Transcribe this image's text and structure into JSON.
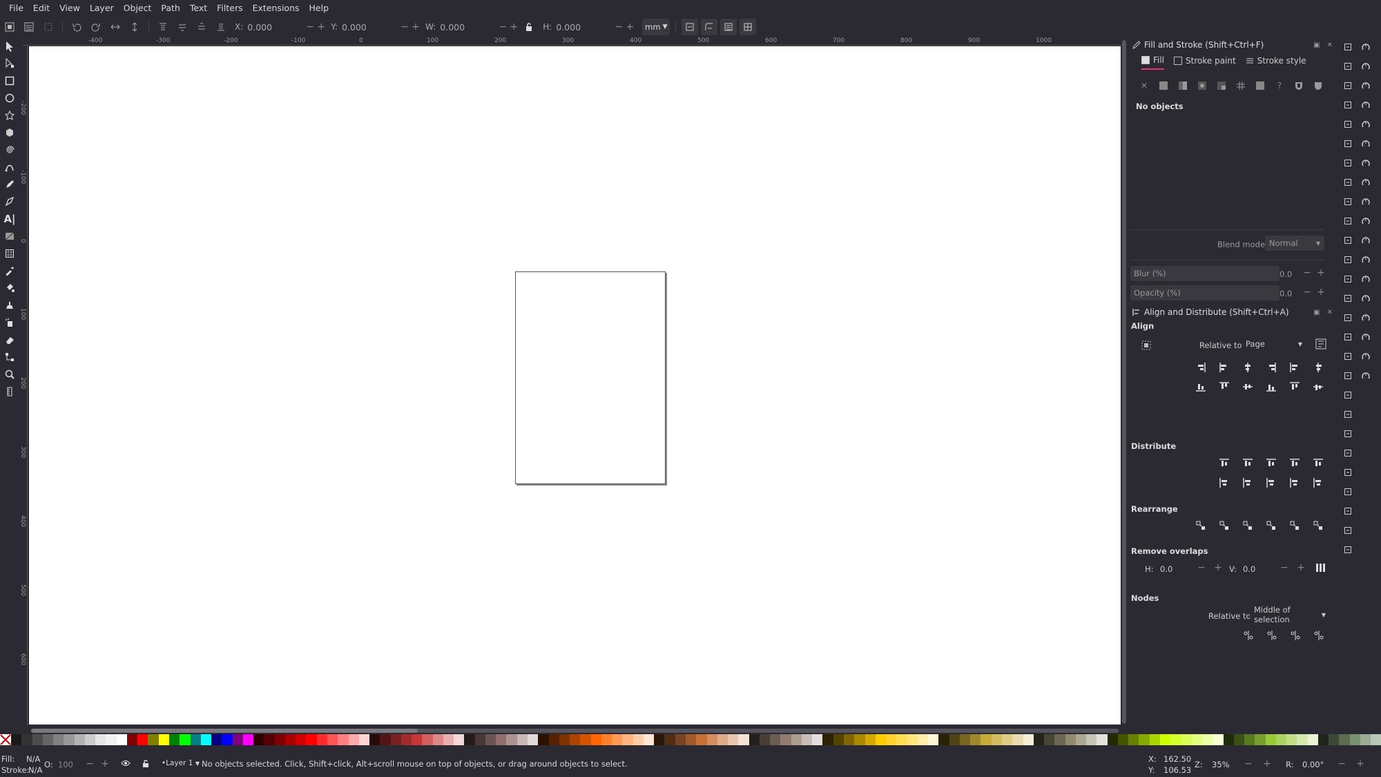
{
  "menu": [
    "File",
    "Edit",
    "View",
    "Layer",
    "Object",
    "Path",
    "Text",
    "Filters",
    "Extensions",
    "Help"
  ],
  "toolbar": {
    "x_label": "X:",
    "x_value": "0.000",
    "y_label": "Y:",
    "y_value": "0.000",
    "w_label": "W:",
    "w_value": "0.000",
    "h_label": "H:",
    "h_value": "0.000",
    "unit": "mm"
  },
  "ruler": {
    "h_ticks": [
      "-400",
      "-300",
      "-200",
      "-100",
      "0",
      "100",
      "200",
      "300",
      "400",
      "500",
      "600",
      "700",
      "800",
      "900",
      "1000"
    ],
    "v_ticks": [
      "-200",
      "-100",
      "0",
      "100",
      "200",
      "300",
      "400",
      "500",
      "600"
    ]
  },
  "fill_stroke": {
    "title": "Fill and Stroke (Shift+Ctrl+F)",
    "tabs": [
      "Fill",
      "Stroke paint",
      "Stroke style"
    ],
    "message": "No objects",
    "blend_label": "Blend mode:",
    "blend_value": "Normal",
    "blur_label": "Blur (%)",
    "blur_value": "0.0",
    "opacity_label": "Opacity (%)",
    "opacity_value": "0.0"
  },
  "align": {
    "title": "Align and Distribute (Shift+Ctrl+A)",
    "align_label": "Align",
    "relative_label": "Relative to:",
    "relative_value": "Page",
    "distribute_label": "Distribute",
    "rearrange_label": "Rearrange",
    "overlaps_label": "Remove overlaps",
    "h_label": "H:",
    "h_value": "0.0",
    "v_label": "V:",
    "v_value": "0.0",
    "nodes_label": "Nodes",
    "nodes_relative_label": "Relative to:",
    "nodes_relative_value": "Middle of selection"
  },
  "palette": [
    "#ffffff",
    "#1a1a1a",
    "#333333",
    "#4d4d4d",
    "#666666",
    "#808080",
    "#999999",
    "#b3b3b3",
    "#cccccc",
    "#e6e6e6",
    "#f2f2f2",
    "#ffffff",
    "#800000",
    "#ff0000",
    "#808000",
    "#ffff00",
    "#008000",
    "#00ff00",
    "#008080",
    "#00ffff",
    "#000080",
    "#0000ff",
    "#800080",
    "#ff00ff",
    "#2b0000",
    "#550000",
    "#800000",
    "#aa0000",
    "#d40000",
    "#ff0000",
    "#ff2a2a",
    "#ff5555",
    "#ff8080",
    "#ffaaaa",
    "#ffd5d5",
    "#280b0b",
    "#501616",
    "#782121",
    "#a02c2c",
    "#c83737",
    "#d35f5f",
    "#de8787",
    "#e9afaf",
    "#f4d7d7",
    "#241c1c",
    "#483737",
    "#6c5353",
    "#916f6f",
    "#ac9393",
    "#c8b7b7",
    "#e3dbdb",
    "#2b1100",
    "#552200",
    "#803300",
    "#aa4400",
    "#d45500",
    "#ff6600",
    "#ff7f2a",
    "#ff9955",
    "#ffb380",
    "#ffccaa",
    "#ffe6d5",
    "#28170b",
    "#502d16",
    "#784421",
    "#a05a2c",
    "#c87137",
    "#d38d5f",
    "#deaa87",
    "#e9c6af",
    "#f4e3d7",
    "#241f1c",
    "#483e37",
    "#6c5d53",
    "#917c6f",
    "#ac9d93",
    "#c8beb7",
    "#e3dedb",
    "#2b2200",
    "#554400",
    "#806600",
    "#aa8800",
    "#d4aa00",
    "#ffcc00",
    "#ffd42a",
    "#ffdd55",
    "#ffe680",
    "#ffeeaa",
    "#fff6d5",
    "#28220b",
    "#504416",
    "#786721",
    "#a0892c",
    "#c8ab37",
    "#d3bc5f",
    "#decd87",
    "#e9ddaf",
    "#f4eed7",
    "#24221c",
    "#484537",
    "#6c6753",
    "#918a6f",
    "#aca793",
    "#c8c4b7",
    "#e3e2db",
    "#222b00",
    "#445500",
    "#668000",
    "#88aa00",
    "#aad400",
    "#ccff00",
    "#d4ff2a",
    "#ddff55",
    "#e5ff80",
    "#eeffaa",
    "#f6ffd5",
    "#1e2b0b",
    "#3c5016",
    "#5a7821",
    "#789f2c",
    "#96c837",
    "#abd35f",
    "#c0de87",
    "#d5e9af",
    "#eaf4d7",
    "#1f241c",
    "#3d4837",
    "#5c6c53",
    "#7a916f",
    "#9aac93",
    "#b7c8b7"
  ],
  "status": {
    "fill_label": "Fill:",
    "fill_value": "N/A",
    "stroke_label": "Stroke:",
    "stroke_value": "N/A",
    "opacity_label": "O:",
    "opacity_value": "100",
    "layer": "•Layer 1",
    "message": "No objects selected. Click, Shift+click, Alt+scroll mouse on top of objects, or drag around objects to select.",
    "x_label": "X:",
    "x_value": "162.50",
    "y_label": "Y:",
    "y_value": "106.53",
    "zoom_label": "Z:",
    "zoom_value": "35%",
    "rotate_label": "R:",
    "rotate_value": "0.00°"
  },
  "colors": {
    "bg": "#2b2a33",
    "canvas": "#ffffff",
    "accent": "#e8316f"
  }
}
